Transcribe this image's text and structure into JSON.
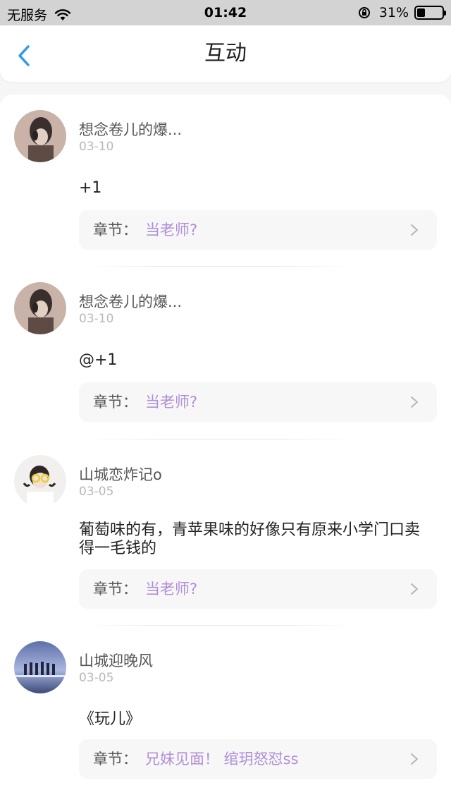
{
  "status_bar": {
    "carrier": "无服务",
    "time": "01:42",
    "battery_text": "31%",
    "battery_level": 0.31
  },
  "header": {
    "title": "互动",
    "back_icon": "chevron-left-icon"
  },
  "comments": [
    {
      "user": "想念卷儿的爆...",
      "date": "03-10",
      "text": "+1",
      "chapter_prefix": "章节：",
      "chapter_title": "当老师?"
    },
    {
      "user": "想念卷儿的爆...",
      "date": "03-10",
      "text": "@+1",
      "chapter_prefix": "章节：",
      "chapter_title": "当老师?"
    },
    {
      "user": "山城恋炸记o",
      "date": "03-05",
      "text": "葡萄味的有，青苹果味的好像只有原来小学门口卖得一毛钱的",
      "chapter_prefix": "章节：",
      "chapter_title": "当老师?"
    },
    {
      "user": "山城迎晚风",
      "date": "03-05",
      "text": "《玩儿》",
      "chapter_prefix": "章节：",
      "chapter_title": "兄妹见面！ 绾玥怒怼ss"
    }
  ],
  "colors": {
    "accent_blue": "#2f9be8",
    "chapter_purple": "#b08fd8",
    "status_gray": "#d3d3d3"
  }
}
